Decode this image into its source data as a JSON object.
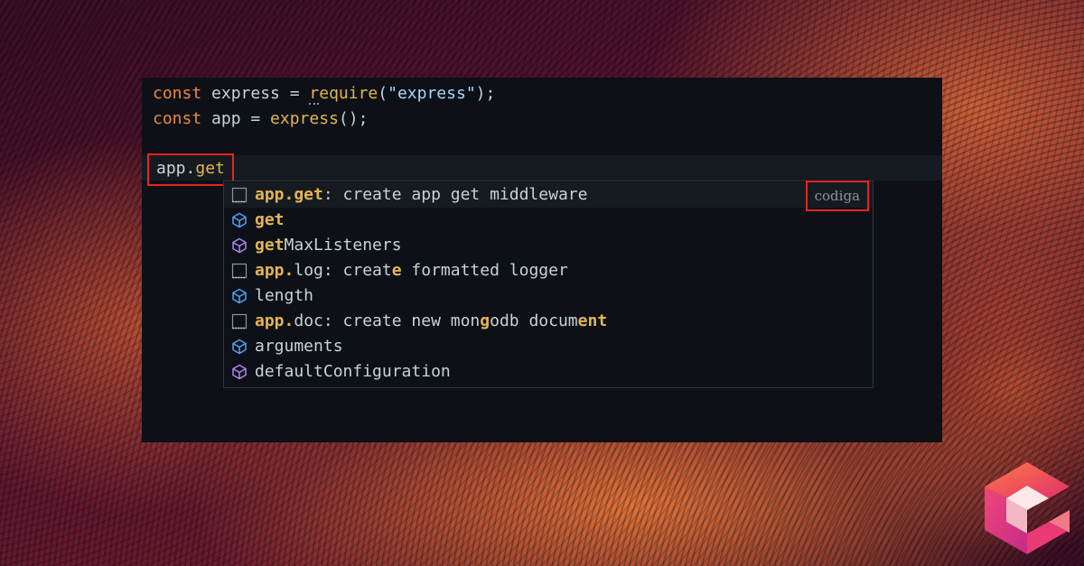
{
  "editor": {
    "line1": {
      "kw": "const",
      "name": " express = ",
      "fn_first": "r",
      "fn_rest": "equire",
      "open": "(",
      "str": "\"express\"",
      "close": ");"
    },
    "line2": {
      "kw": "const",
      "name": " app = ",
      "fn": "express",
      "rest": "();"
    },
    "typed": {
      "obj": "app.",
      "method": "get"
    }
  },
  "suggestions": [
    {
      "icon": "snippet-icon",
      "parts": [
        {
          "t": "app.get",
          "hl": true
        },
        {
          "t": ": create app get middleware",
          "hl": false
        }
      ],
      "source": "codiga",
      "selected": true
    },
    {
      "icon": "property-icon",
      "parts": [
        {
          "t": "get",
          "hl": true
        }
      ]
    },
    {
      "icon": "method-icon",
      "parts": [
        {
          "t": "get",
          "hl": true
        },
        {
          "t": "MaxListeners",
          "hl": false
        }
      ]
    },
    {
      "icon": "snippet-icon",
      "parts": [
        {
          "t": "app.",
          "hl": true
        },
        {
          "t": "log: creat",
          "hl": false
        },
        {
          "t": "e",
          "hl": true
        },
        {
          "t": " formatted logger",
          "hl": false
        }
      ]
    },
    {
      "icon": "property-icon",
      "parts": [
        {
          "t": "length",
          "hl": false
        }
      ]
    },
    {
      "icon": "snippet-icon",
      "parts": [
        {
          "t": "app.",
          "hl": true
        },
        {
          "t": "doc: create new mon",
          "hl": false
        },
        {
          "t": "g",
          "hl": true
        },
        {
          "t": "odb docum",
          "hl": false
        },
        {
          "t": "e",
          "hl": true
        },
        {
          "t": "nt",
          "hl": true
        }
      ]
    },
    {
      "icon": "property-icon",
      "parts": [
        {
          "t": "arguments",
          "hl": false
        }
      ]
    },
    {
      "icon": "method-icon",
      "parts": [
        {
          "t": "defaultConfiguration",
          "hl": false
        }
      ]
    }
  ],
  "colors": {
    "accent": "#e6b450",
    "keyword": "#f0883e",
    "string": "#a5d6ff",
    "highlight_box": "#e5251e",
    "property_icon": "#4fa3f7",
    "method_icon": "#b083f0"
  },
  "brand": {
    "logo": "codiga-logo"
  }
}
